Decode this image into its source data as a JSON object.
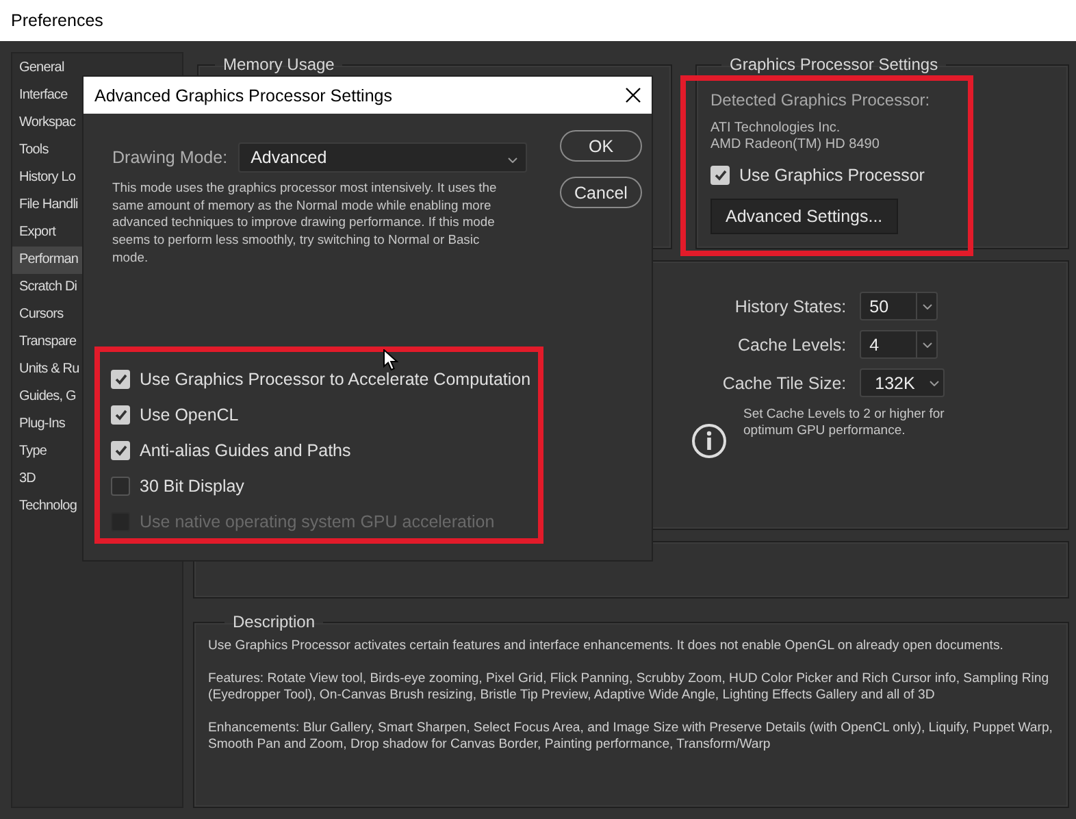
{
  "window": {
    "title": "Preferences"
  },
  "sidebar": {
    "items": [
      {
        "label": "General",
        "selected": false
      },
      {
        "label": "Interface",
        "selected": false
      },
      {
        "label": "Workspac",
        "selected": false
      },
      {
        "label": "Tools",
        "selected": false
      },
      {
        "label": "History Lo",
        "selected": false
      },
      {
        "label": "File Handli",
        "selected": false
      },
      {
        "label": "Export",
        "selected": false
      },
      {
        "label": "Performan",
        "selected": true
      },
      {
        "label": "Scratch Di",
        "selected": false
      },
      {
        "label": "Cursors",
        "selected": false
      },
      {
        "label": "Transpare",
        "selected": false
      },
      {
        "label": "Units & Ru",
        "selected": false
      },
      {
        "label": "Guides, G",
        "selected": false
      },
      {
        "label": "Plug-Ins",
        "selected": false
      },
      {
        "label": "Type",
        "selected": false
      },
      {
        "label": "3D",
        "selected": false
      },
      {
        "label": "Technolog",
        "selected": false
      }
    ]
  },
  "memory_usage": {
    "title": "Memory Usage"
  },
  "graphics_processor_settings": {
    "title": "Graphics Processor Settings",
    "detected_label": "Detected Graphics Processor:",
    "vendor": "ATI Technologies Inc.",
    "model": "AMD Radeon(TM) HD 8490",
    "use_gpu": {
      "label": "Use Graphics Processor",
      "checked": true
    },
    "advanced_button": "Advanced Settings..."
  },
  "history_cache": {
    "fields": [
      {
        "label": "History States:",
        "value": "50",
        "kind": "combo"
      },
      {
        "label": "Cache Levels:",
        "value": "4",
        "kind": "combo"
      },
      {
        "label": "Cache Tile Size:",
        "value": "132K",
        "kind": "dropdown"
      }
    ],
    "note": "Set Cache Levels to 2 or higher for optimum GPU performance."
  },
  "description": {
    "title": "Description",
    "paragraphs": [
      "Use Graphics Processor activates certain features and interface enhancements. It does not enable OpenGL on already open documents.",
      "Features: Rotate View tool, Birds-eye zooming, Pixel Grid, Flick Panning, Scrubby Zoom, HUD Color Picker and Rich Cursor info, Sampling Ring (Eyedropper Tool), On-Canvas Brush resizing, Bristle Tip Preview, Adaptive Wide Angle, Lighting Effects Gallery and all of 3D",
      "Enhancements: Blur Gallery, Smart Sharpen, Select Focus Area, and Image Size with Preserve Details (with OpenCL only), Liquify, Puppet Warp, Smooth Pan and Zoom, Drop shadow for Canvas Border, Painting performance, Transform/Warp"
    ]
  },
  "dialog": {
    "title": "Advanced Graphics Processor Settings",
    "drawing_mode": {
      "label": "Drawing Mode:",
      "value": "Advanced"
    },
    "mode_description": "This mode uses the graphics processor most intensively.  It uses the same amount of memory as the Normal mode while enabling more advanced techniques to improve drawing performance.  If this mode seems to perform less smoothly, try switching to Normal or Basic mode.",
    "buttons": [
      "OK",
      "Cancel"
    ],
    "options": [
      {
        "label": "Use Graphics Processor to Accelerate Computation",
        "checked": true,
        "disabled": false
      },
      {
        "label": "Use OpenCL",
        "checked": true,
        "disabled": false
      },
      {
        "label": "Anti-alias Guides and Paths",
        "checked": true,
        "disabled": false
      },
      {
        "label": "30 Bit Display",
        "checked": false,
        "disabled": false
      },
      {
        "label": "Use native operating system GPU acceleration",
        "checked": false,
        "disabled": true
      }
    ]
  },
  "annotations": {
    "gpu_settings_highlighted": true,
    "dialog_options_highlighted": true
  }
}
